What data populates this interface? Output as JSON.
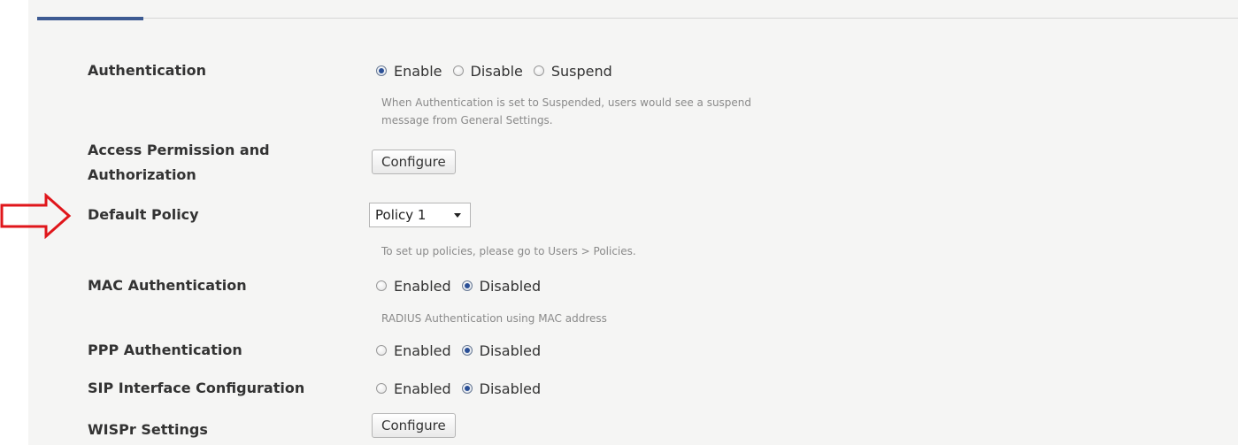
{
  "authentication": {
    "label": "Authentication",
    "options": [
      "Enable",
      "Disable",
      "Suspend"
    ],
    "selected": "Enable",
    "hint_line1": "When Authentication is set to Suspended, users would see a suspend",
    "hint_line2": "message from General Settings."
  },
  "access_permission": {
    "label_line1": "Access Permission and",
    "label_line2": "Authorization",
    "button_label": "Configure"
  },
  "default_policy": {
    "label": "Default Policy",
    "selected_value": "Policy 1",
    "hint": "To set up policies, please go to Users > Policies."
  },
  "mac_authentication": {
    "label": "MAC Authentication",
    "options": [
      "Enabled",
      "Disabled"
    ],
    "selected": "Disabled",
    "hint": "RADIUS Authentication using MAC address"
  },
  "ppp_authentication": {
    "label": "PPP Authentication",
    "options": [
      "Enabled",
      "Disabled"
    ],
    "selected": "Disabled"
  },
  "sip_interface": {
    "label": "SIP Interface Configuration",
    "options": [
      "Enabled",
      "Disabled"
    ],
    "selected": "Disabled"
  },
  "wispr": {
    "label": "WISPr Settings",
    "button_label": "Configure"
  },
  "colors": {
    "annotation_arrow": "#e0161b",
    "accent": "#3d5a92",
    "panel_background": "#f5f5f4"
  }
}
